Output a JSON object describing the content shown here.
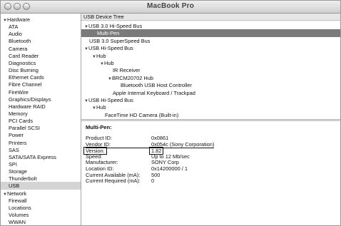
{
  "window": {
    "title": "MacBook Pro"
  },
  "sidebar": {
    "items": [
      {
        "label": "Hardware",
        "type": "category"
      },
      {
        "label": "ATA",
        "type": "item"
      },
      {
        "label": "Audio",
        "type": "item"
      },
      {
        "label": "Bluetooth",
        "type": "item"
      },
      {
        "label": "Camera",
        "type": "item"
      },
      {
        "label": "Card Reader",
        "type": "item"
      },
      {
        "label": "Diagnostics",
        "type": "item"
      },
      {
        "label": "Disc Burning",
        "type": "item"
      },
      {
        "label": "Ethernet Cards",
        "type": "item"
      },
      {
        "label": "Fibre Channel",
        "type": "item"
      },
      {
        "label": "FireWire",
        "type": "item"
      },
      {
        "label": "Graphics/Displays",
        "type": "item"
      },
      {
        "label": "Hardware RAID",
        "type": "item"
      },
      {
        "label": "Memory",
        "type": "item"
      },
      {
        "label": "PCI Cards",
        "type": "item"
      },
      {
        "label": "Parallel SCSI",
        "type": "item"
      },
      {
        "label": "Power",
        "type": "item"
      },
      {
        "label": "Printers",
        "type": "item"
      },
      {
        "label": "SAS",
        "type": "item"
      },
      {
        "label": "SATA/SATA Express",
        "type": "item"
      },
      {
        "label": "SPI",
        "type": "item"
      },
      {
        "label": "Storage",
        "type": "item"
      },
      {
        "label": "Thunderbolt",
        "type": "item"
      },
      {
        "label": "USB",
        "type": "item",
        "selected": true
      },
      {
        "label": "Network",
        "type": "category"
      },
      {
        "label": "Firewall",
        "type": "item"
      },
      {
        "label": "Locations",
        "type": "item"
      },
      {
        "label": "Volumes",
        "type": "item"
      },
      {
        "label": "WWAN",
        "type": "item"
      }
    ]
  },
  "tree": {
    "header": "USB Device Tree",
    "rows": [
      {
        "label": "USB 3.0 Hi-Speed Bus",
        "depth": 0,
        "expanded": true
      },
      {
        "label": "Multi-Pen",
        "depth": 1,
        "selected": true
      },
      {
        "label": "USB 3.0 SuperSpeed Bus",
        "depth": 0
      },
      {
        "label": "USB Hi-Speed Bus",
        "depth": 0,
        "expanded": true
      },
      {
        "label": "Hub",
        "depth": 1,
        "expanded": true
      },
      {
        "label": "Hub",
        "depth": 2,
        "expanded": true
      },
      {
        "label": "IR Receiver",
        "depth": 3
      },
      {
        "label": "BRCM20702 Hub",
        "depth": 3,
        "expanded": true
      },
      {
        "label": "Bluetooth USB Host Controller",
        "depth": 4
      },
      {
        "label": "Apple Internal Keyboard / Trackpad",
        "depth": 3
      },
      {
        "label": "USB Hi-Speed Bus",
        "depth": 0,
        "expanded": true
      },
      {
        "label": "Hub",
        "depth": 1,
        "expanded": true
      },
      {
        "label": "FaceTime HD Camera (Built-in)",
        "depth": 2
      }
    ]
  },
  "details": {
    "title": "Multi-Pen:",
    "properties": [
      {
        "label": "Product ID:",
        "value": "0x0861"
      },
      {
        "label": "Vendor ID:",
        "value": "0x054c  (Sony Corporation)",
        "underline": true
      },
      {
        "label": "Version:",
        "value": "1.82",
        "boxed": true
      },
      {
        "label": "Speed:",
        "value": "Up to 12 Mb/sec"
      },
      {
        "label": "Manufacturer:",
        "value": "SONY Corp"
      },
      {
        "label": "Location ID:",
        "value": "0x14200000 / 1"
      },
      {
        "label": "Current Available (mA):",
        "value": "500"
      },
      {
        "label": "Current Required (mA):",
        "value": "0"
      }
    ]
  },
  "icons": {
    "expanded": "disclosure-triangle-down-icon",
    "window_buttons": [
      "close-icon",
      "minimize-icon",
      "zoom-icon"
    ]
  },
  "colors": {
    "selected_tree_row": "#7a7a7a",
    "selected_sidebar_row": "#d4d4d4"
  }
}
